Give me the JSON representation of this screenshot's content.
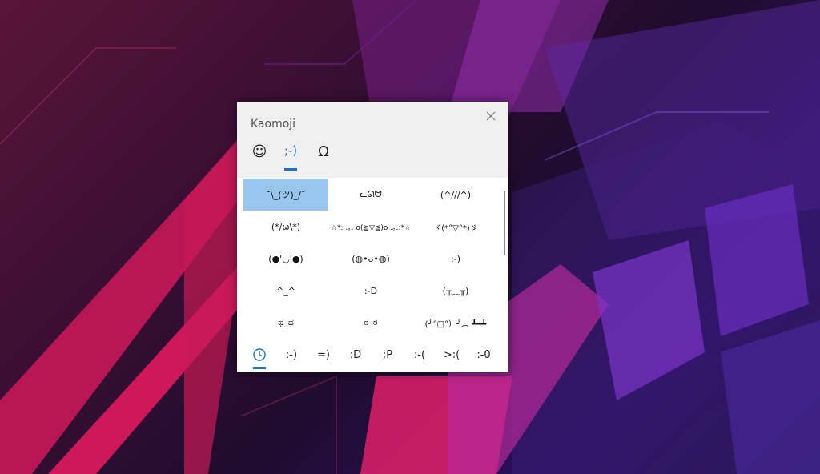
{
  "panel": {
    "title": "Kaomoji",
    "close_glyph": "✕",
    "tabs": [
      {
        "label": "☺",
        "name": "emoji"
      },
      {
        "label": ";-)",
        "name": "kaomoji"
      },
      {
        "label": "Ω",
        "name": "symbols"
      }
    ],
    "active_tab": "kaomoji",
    "kaomoji": [
      "¯\\_(ツ)_/¯",
      "ᓚᘏᗢ",
      "(^///^)",
      "(*/ω\\*)",
      "☆*: .｡. o(≧▽≦)o .｡.:*☆",
      "ヾ(*°▽°*)ゞ",
      "(●'◡'●)",
      "(◍•ᴗ•◍)",
      ":-)",
      "^_^",
      ":-D",
      "(╥﹏╥)",
      "ಥ_ಥ",
      "ಠ_ಠ",
      "(╯°□°）╯︵ ┻━┻"
    ],
    "selected_index": 0,
    "recents_icon": "clock-icon",
    "recents": [
      ":-)",
      "=)",
      ":D",
      ";P",
      ":-(",
      ">:(",
      ":-0"
    ]
  },
  "colors": {
    "accent": "#1a73c9",
    "selected_bg": "#99c6ec",
    "panel_bg": "#ffffff",
    "header_bg": "#f0f0f0"
  }
}
